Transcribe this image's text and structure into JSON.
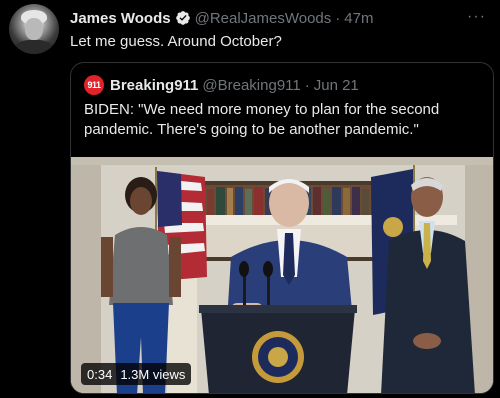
{
  "tweet": {
    "author_name": "James Woods",
    "handle": "@RealJamesWoods",
    "separator": "·",
    "time": "47m",
    "text": "Let me guess. Around October?",
    "more_icon": "more-icon"
  },
  "quote": {
    "avatar_label": "911",
    "author_name": "Breaking911",
    "handle": "@Breaking911",
    "separator": "·",
    "date": "Jun 21",
    "text": "BIDEN: \"We need more money to plan for the second pandemic. There's going to be another pandemic.\""
  },
  "video": {
    "duration": "0:34",
    "views": "1.3M views"
  },
  "colors": {
    "background": "#000000",
    "text": "#e7e9ea",
    "muted": "#71767b",
    "verified": "#1d9bf0",
    "border": "#2f3336",
    "breaking911_red": "#e0242a"
  }
}
